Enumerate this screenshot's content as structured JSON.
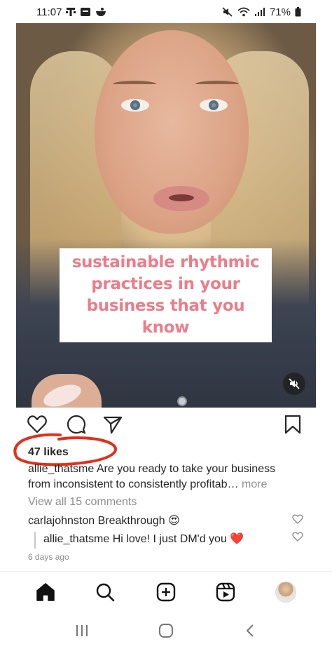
{
  "status_bar": {
    "time": "11:07",
    "battery": "71%",
    "left_icons": [
      "t-mobile-icon",
      "app-notification-icon",
      "bowl-icon"
    ],
    "right_icons": [
      "mute-icon",
      "wifi-icon",
      "signal-icon",
      "battery-icon"
    ]
  },
  "post": {
    "video_caption": "sustainable rhythmic practices in your business that you know",
    "likes": "47 likes",
    "caption": {
      "username": "allie_thatsme",
      "text_line1": "Are you ready to take your business",
      "text_line2": "from inconsistent to consistently profitab",
      "ellipsis": "…",
      "more": "more"
    },
    "view_all_comments": "View all 15 comments",
    "comments": [
      {
        "username": "carlajohnston",
        "text": "Breakthrough",
        "emoji": "😍"
      },
      {
        "username": "allie_thatsme",
        "text": "Hi love! I just DM'd you",
        "emoji": "❤️"
      }
    ],
    "timestamp": "6 days ago"
  },
  "colors": {
    "caption_text": "#ec7c8a",
    "annotation": "#e2301a",
    "text": "#262626",
    "secondary": "#8e8e8e",
    "heart": "#e0245e"
  },
  "bottom_nav": [
    "home-icon",
    "search-icon",
    "create-icon",
    "reels-icon",
    "profile-avatar"
  ],
  "system_nav": [
    "recent-apps-icon",
    "home-circle-icon",
    "back-icon"
  ]
}
